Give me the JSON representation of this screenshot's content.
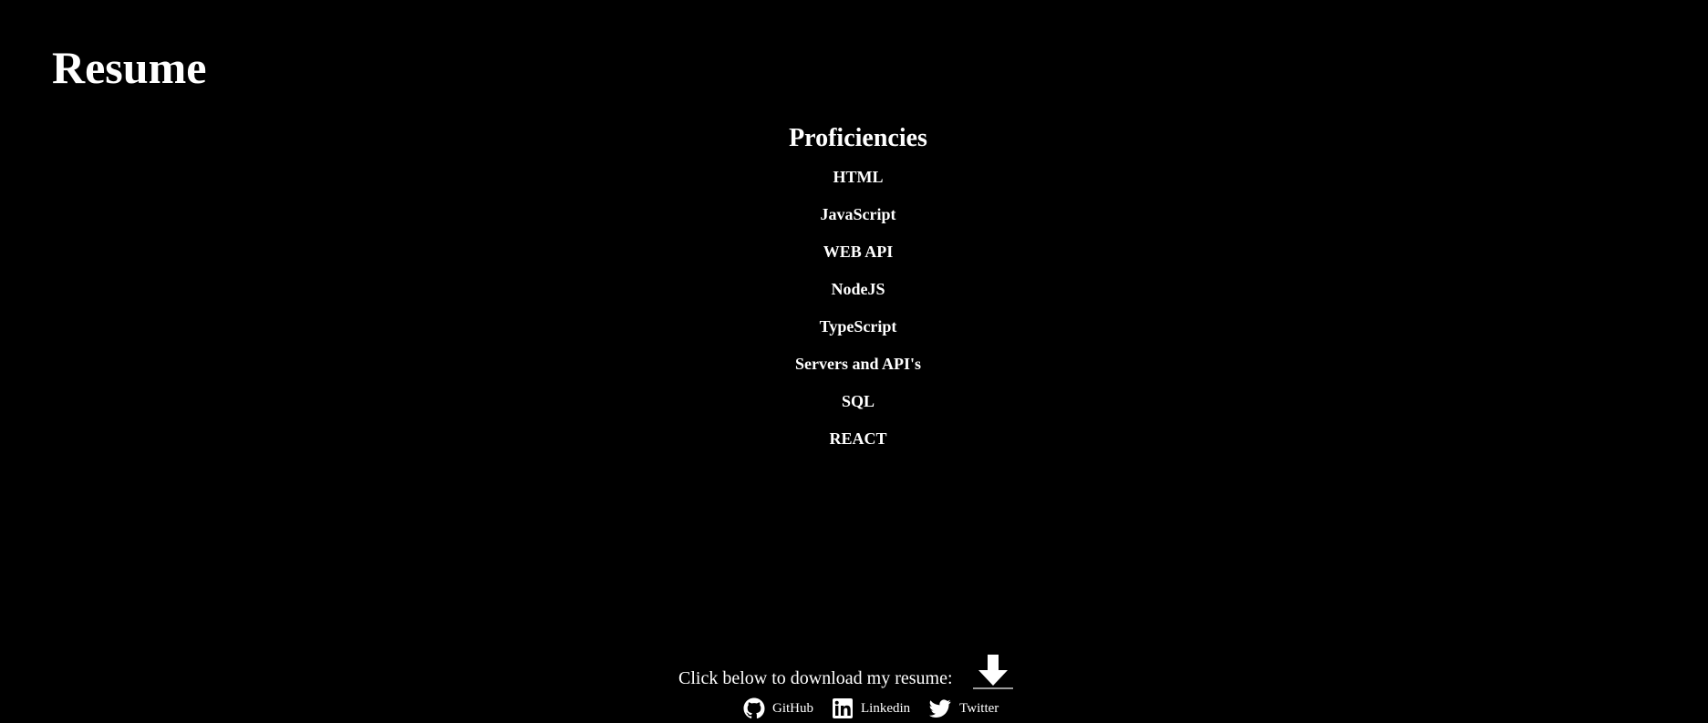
{
  "header": {
    "title": "Resume"
  },
  "proficiencies": {
    "title": "Proficiencies",
    "items": [
      "HTML",
      "JavaScript",
      "WEB API",
      "NodeJS",
      "TypeScript",
      "Servers and API's",
      "SQL",
      "REACT"
    ]
  },
  "footer": {
    "download_text": "Click below to download my resume:",
    "download_icon": "download-arrow-icon",
    "links": [
      {
        "label": "GitHub",
        "icon": "github-icon"
      },
      {
        "label": "Linkedin",
        "icon": "linkedin-icon"
      },
      {
        "label": "Twitter",
        "icon": "twitter-icon"
      }
    ]
  },
  "colors": {
    "background": "#000000",
    "text": "#ffffff"
  }
}
